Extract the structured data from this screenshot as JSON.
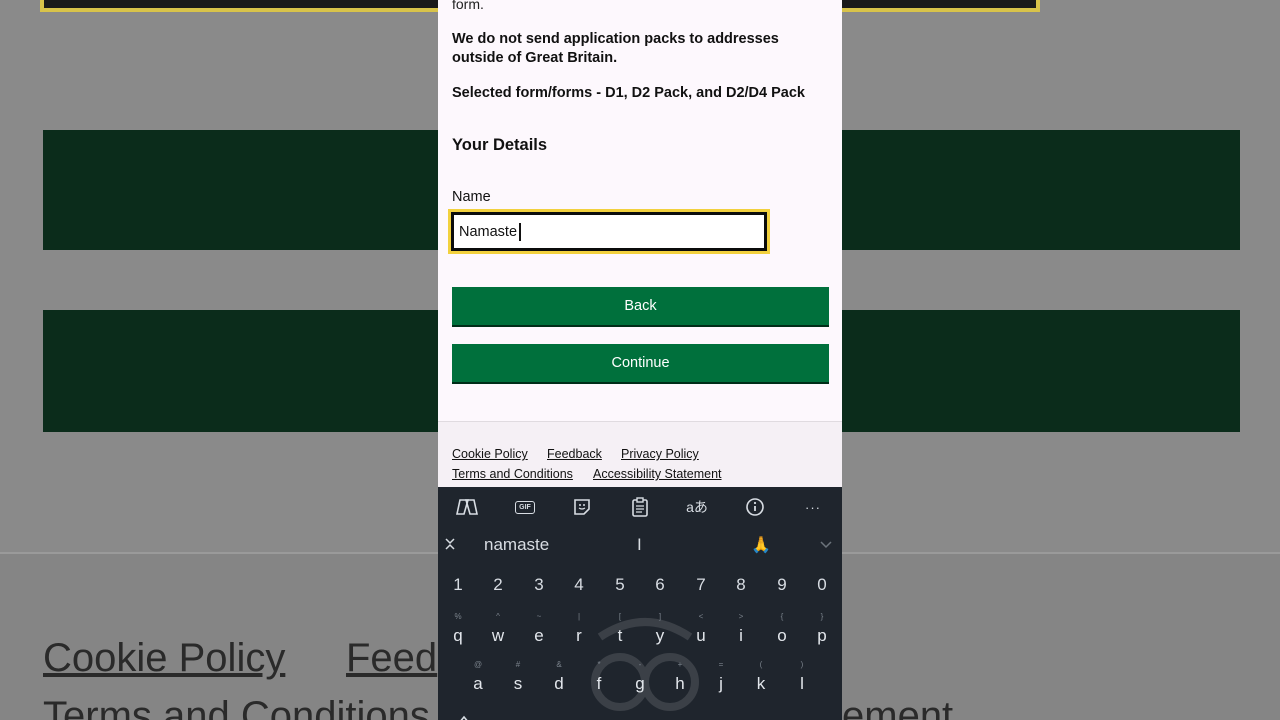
{
  "background": {
    "links": [
      "Cookie Policy",
      "Feed",
      "Terms and Conditions",
      "ement"
    ]
  },
  "page": {
    "partial_text": "form.",
    "notice": "We do not send application packs to addresses outside of Great Britain.",
    "selected_forms": "Selected form/forms - D1, D2 Pack, and D2/D4 Pack",
    "section_heading": "Your Details",
    "name_label": "Name",
    "name_value": "Namaste",
    "back_label": "Back",
    "continue_label": "Continue"
  },
  "footer": {
    "cookie_policy": "Cookie Policy",
    "feedback": "Feedback",
    "privacy_policy": "Privacy Policy",
    "terms": "Terms and Conditions",
    "accessibility": "Accessibility Statement"
  },
  "keyboard": {
    "toolbar_icons": [
      "copilot-icon",
      "gif-icon",
      "sticker-icon",
      "clipboard-icon",
      "translate-icon",
      "info-icon",
      "more-icon"
    ],
    "gif_label": "GIF",
    "translate_label": "aあ",
    "more_label": "···",
    "suggestions": [
      "namaste",
      "I",
      "🙏"
    ],
    "numbers": [
      "1",
      "2",
      "3",
      "4",
      "5",
      "6",
      "7",
      "8",
      "9",
      "0"
    ],
    "row1": [
      "q",
      "w",
      "e",
      "r",
      "t",
      "y",
      "u",
      "i",
      "o",
      "p"
    ],
    "row1_sub": [
      "%",
      "^",
      "~",
      "|",
      "[",
      "]",
      "<",
      ">",
      "{",
      "}"
    ],
    "row2": [
      "a",
      "s",
      "d",
      "f",
      "g",
      "h",
      "j",
      "k",
      "l"
    ],
    "row2_sub": [
      "@",
      "#",
      "&",
      "*",
      "-",
      "+",
      "=",
      "(",
      ")"
    ],
    "colors": {
      "background": "#1f252d",
      "key_text": "#e3e7ec"
    }
  },
  "colors": {
    "button_green": "#00703c",
    "focus_yellow": "#f2d13e"
  }
}
